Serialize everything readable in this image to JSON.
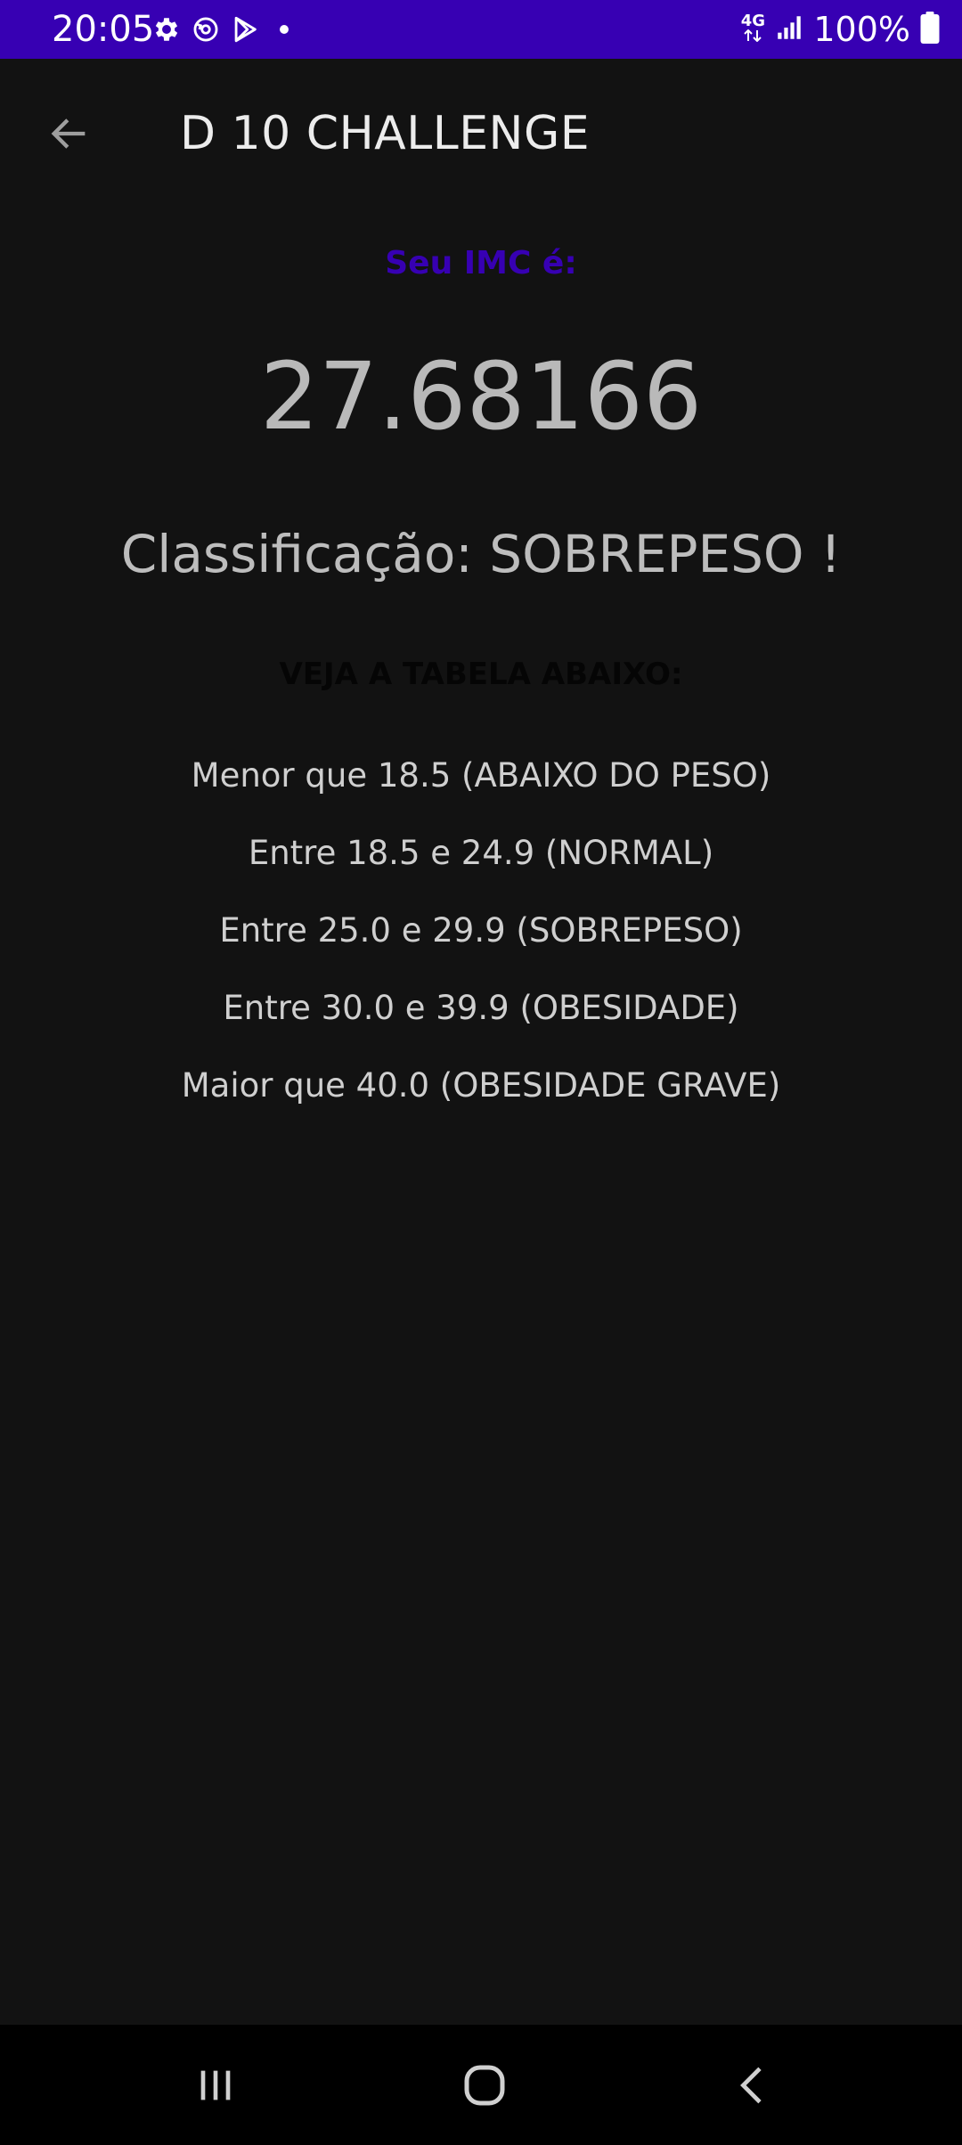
{
  "status_bar": {
    "time": "20:05",
    "left_icons": [
      "gear-icon",
      "sync-icon",
      "play-store-icon",
      "dot-icon"
    ],
    "network": "4G",
    "battery_text": "100%",
    "background_color": "#3700b3"
  },
  "app_bar": {
    "title": "D 10 CHALLENGE",
    "back_icon": "arrow-left-icon"
  },
  "result": {
    "label": "Seu IMC é:",
    "value": "27.68166",
    "classification": "Classificação: SOBREPESO !",
    "label_color": "#3700b3"
  },
  "table": {
    "heading": "VEJA A TABELA ABAIXO:",
    "rows": [
      "Menor que 18.5 (ABAIXO DO PESO)",
      "Entre 18.5 e 24.9 (NORMAL)",
      "Entre 25.0 e 29.9 (SOBREPESO)",
      "Entre 30.0 e 39.9 (OBESIDADE)",
      "Maior que 40.0 (OBESIDADE GRAVE)"
    ]
  },
  "nav_bar": {
    "buttons": [
      "recent-apps-icon",
      "home-icon",
      "back-icon"
    ]
  }
}
